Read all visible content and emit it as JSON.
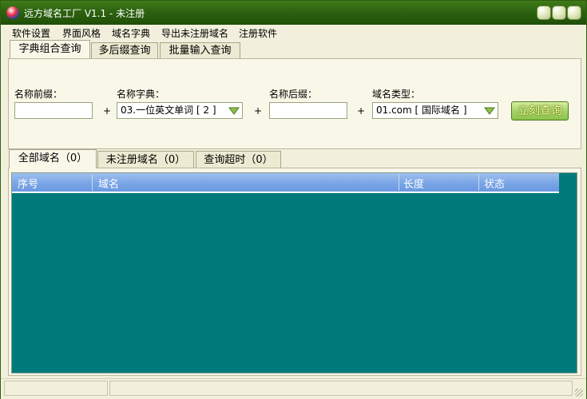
{
  "window": {
    "title": "远方域名工厂 V1.1 - 未注册"
  },
  "menu": {
    "items": [
      "软件设置",
      "界面风格",
      "域名字典",
      "导出未注册域名",
      "注册软件"
    ]
  },
  "query_tabs": [
    {
      "label": "字典组合查询",
      "active": true
    },
    {
      "label": "多后缀查询",
      "active": false
    },
    {
      "label": "批量输入查询",
      "active": false
    }
  ],
  "form": {
    "prefix_label": "名称前缀：",
    "prefix_value": "",
    "dict_label": "名称字典：",
    "dict_value": "03.一位英文单词 [ 2 ]",
    "suffix_label": "名称后缀：",
    "suffix_value": "",
    "type_label": "域名类型：",
    "type_value": "01.com [ 国际域名 ]",
    "plus": "+",
    "submit": "立刻查询"
  },
  "result_tabs": [
    {
      "label": "全部域名（0）",
      "active": true
    },
    {
      "label": "未注册域名（0）",
      "active": false
    },
    {
      "label": "查询超时（0）",
      "active": false
    }
  ],
  "table": {
    "columns": [
      "序号",
      "域名",
      "长度",
      "状态"
    ],
    "rows": []
  },
  "colors": {
    "titlebar": "#2d6310",
    "grid_bg": "#007b7b",
    "header": "#7aa5e6",
    "window_bg": "#f2f0dc"
  }
}
